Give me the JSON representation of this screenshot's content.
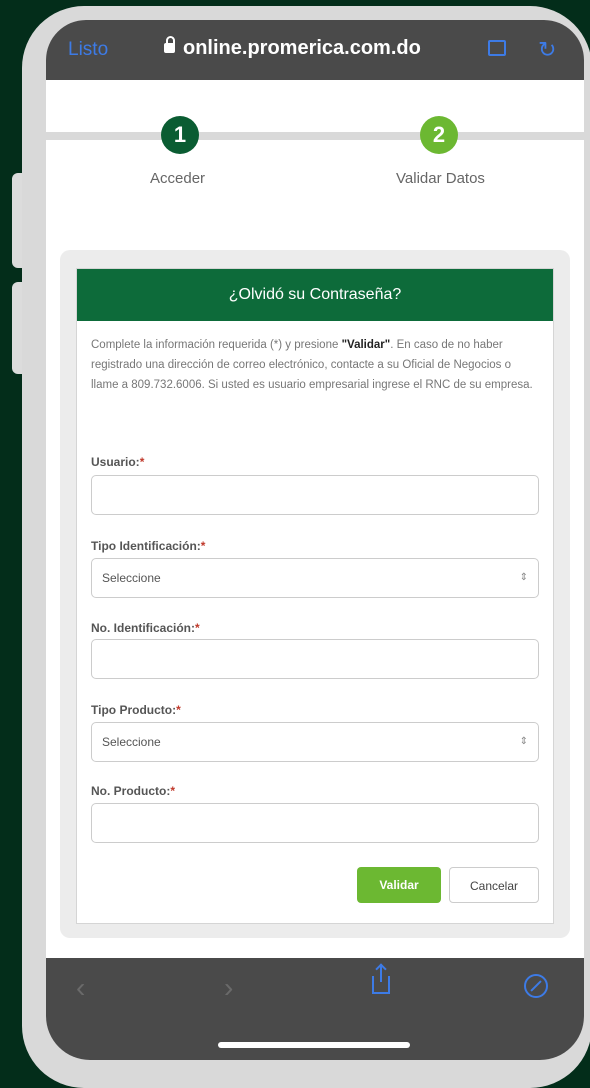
{
  "browser": {
    "done_label": "Listo",
    "url": "online.promerica.com.do"
  },
  "stepper": {
    "steps": [
      {
        "number": "1",
        "label": "Acceder"
      },
      {
        "number": "2",
        "label": "Validar Datos"
      }
    ]
  },
  "form": {
    "title": "¿Olvidó su Contraseña?",
    "intro_before": "Complete la información requerida (*) y presione ",
    "intro_bold": "\"Validar\"",
    "intro_after": ". En caso de no haber registrado una dirección de correo electrónico, contacte a su Oficial de Negocios o llame a 809.732.6006. Si usted es usuario empresarial ingrese el RNC de su empresa.",
    "required_mark": "*",
    "fields": {
      "usuario": {
        "label": "Usuario:",
        "value": ""
      },
      "tipo_identificacion": {
        "label": "Tipo Identificación:",
        "value": "Seleccione"
      },
      "no_identificacion": {
        "label": "No. Identificación:",
        "value": ""
      },
      "tipo_producto": {
        "label": "Tipo Producto:",
        "value": "Seleccione"
      },
      "no_producto": {
        "label": "No. Producto:",
        "value": ""
      }
    },
    "validate_label": "Validar",
    "cancel_label": "Cancelar"
  },
  "colors": {
    "brand_dark_green": "#0d6b3a",
    "accent_green": "#6cb832",
    "link_blue": "#3d7be6"
  }
}
